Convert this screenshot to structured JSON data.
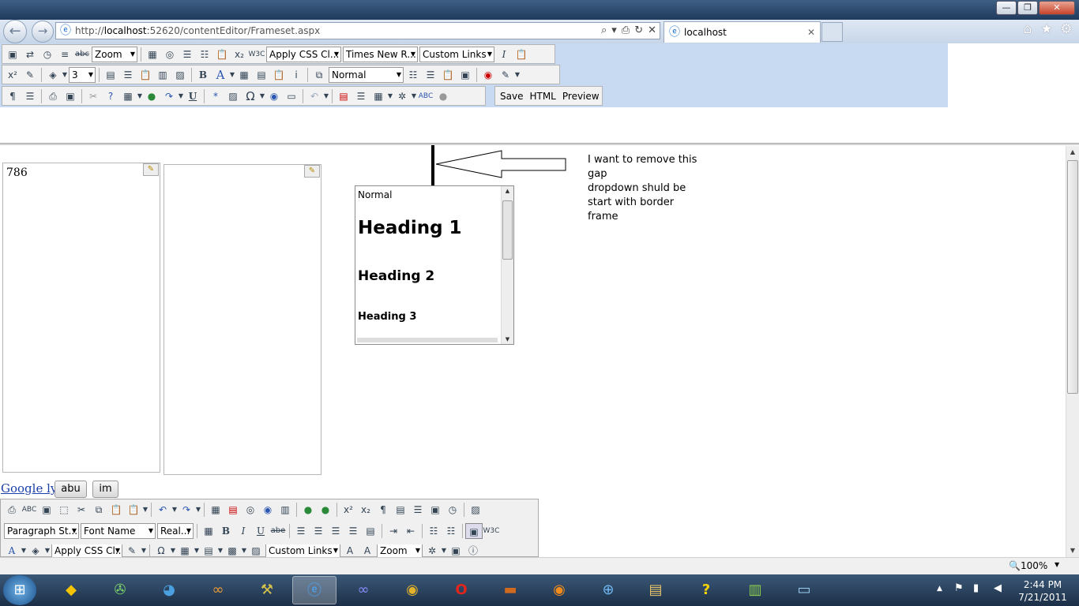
{
  "window": {
    "minimize_glyph": "—",
    "restore_glyph": "❐",
    "close_glyph": "✕"
  },
  "browser": {
    "back_glyph": "←",
    "forward_glyph": "→",
    "address_prefix": "http://",
    "address_host": "localhost",
    "address_rest": ":52620/contentEditor/Frameset.aspx",
    "address_controls": [
      "⌕",
      "▾",
      "⎙",
      "↻",
      "✕"
    ],
    "tab_title": "localhost",
    "tab_close": "✕",
    "home_glyph": "⌂",
    "favorites_glyph": "★",
    "tools_glyph": "⚙"
  },
  "editor_toolbar": {
    "row1": {
      "icons_before": [
        "find-icon",
        "replace-icon",
        "clock-icon",
        "indent-icon",
        "abc"
      ],
      "zoom": "Zoom",
      "apply_css": "Apply CSS Cl...",
      "font_name": "Times New R...",
      "custom_links": "Custom Links",
      "italic_label": "I"
    },
    "row2": {
      "superscript": "x²",
      "font_size": "3",
      "bold_label": "B",
      "font_color_label": "A",
      "paragraph": "Normal"
    },
    "row3": {
      "underline_label": "U",
      "omega_label": "Ω",
      "save": "Save",
      "html": "HTML",
      "preview": "Preview"
    }
  },
  "left_frame": {
    "content": "786"
  },
  "dropdown_list": {
    "items": [
      "Normal",
      "Heading 1",
      "Heading 2",
      "Heading 3"
    ]
  },
  "annotation": {
    "line1": "I want to remove this",
    "line2": "gap",
    "line3": "dropdown shuld be",
    "line4": "start with border",
    "line5": "frame"
  },
  "lower_controls": {
    "link": "Google ly",
    "button1": "abu",
    "button2": "im"
  },
  "bottom_toolbar": {
    "paragraph_style": "Paragraph St...",
    "font_name": "Font Name",
    "font_size": "Real...",
    "apply_css": "Apply CSS Cl...",
    "custom_links": "Custom Links",
    "zoom": "Zoom",
    "bold": "B",
    "italic": "I",
    "underline": "U",
    "strike": "abe"
  },
  "statusbar": {
    "zoom_level": "100%"
  },
  "taskbar": {
    "time": "2:44 PM",
    "date": "7/21/2011"
  },
  "colors": {
    "toolbar_band": "#c7daf1",
    "titlebar": "#2c4a6e",
    "taskbar": "#243a56"
  }
}
